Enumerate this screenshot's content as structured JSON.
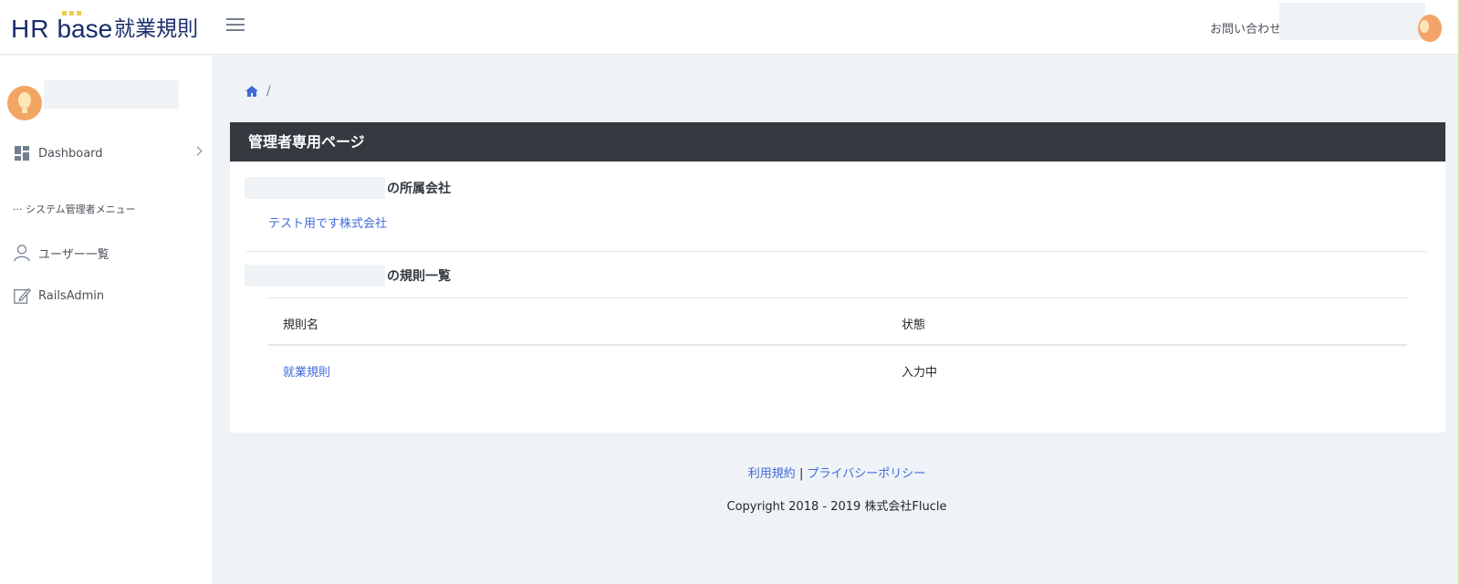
{
  "header": {
    "logo_hr": "HR",
    "logo_base": "base",
    "logo_jp": "就業規則",
    "contact_label": "お問い合わせ"
  },
  "sidebar": {
    "items": [
      {
        "label": "Dashboard",
        "icon": "dashboard-icon"
      },
      {
        "label": "ユーザー一覧",
        "icon": "user-icon"
      },
      {
        "label": "RailsAdmin",
        "icon": "edit-icon"
      }
    ],
    "section_title": "··· システム管理者メニュー"
  },
  "breadcrumb": {
    "separator": "/"
  },
  "card": {
    "title": "管理者専用ページ",
    "company_section_suffix": "の所属会社",
    "company_name": "テスト用です株式会社",
    "rules_section_suffix": "の規則一覧",
    "table": {
      "headers": [
        "規則名",
        "状態"
      ],
      "rows": [
        {
          "name": "就業規則",
          "status": "入力中"
        }
      ]
    }
  },
  "footer": {
    "terms_link": "利用規約",
    "separator": "|",
    "privacy_link": "プライバシーポリシー",
    "copyright": "Copyright 2018 - 2019 株式会社Flucle"
  },
  "colors": {
    "brand": "#1a2d6b",
    "link": "#3f6ad8",
    "card_header": "#343a40",
    "background": "#eff3f7"
  }
}
